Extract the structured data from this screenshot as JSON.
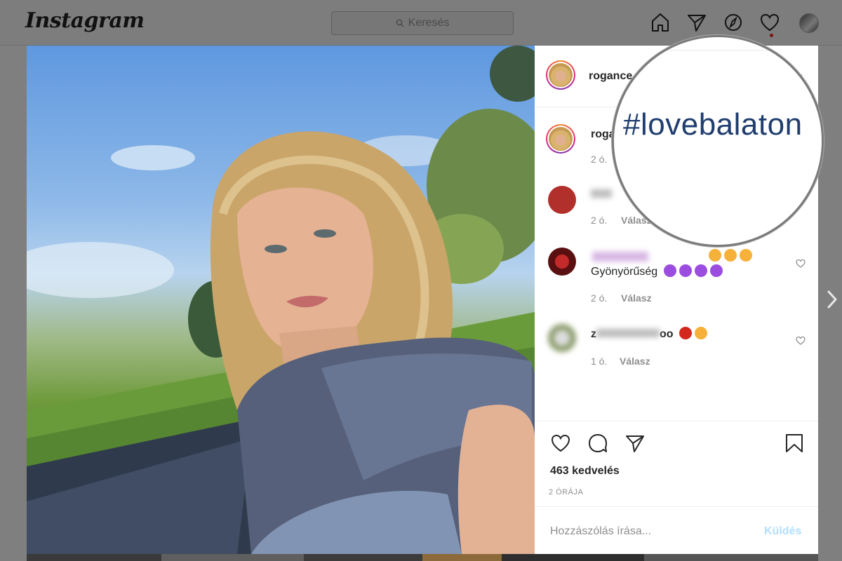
{
  "nav": {
    "logo": "Instagram",
    "search_placeholder": "Keresés",
    "icons": [
      "home-icon",
      "direct-icon",
      "explore-icon",
      "activity-icon",
      "profile-avatar"
    ]
  },
  "post": {
    "username": "rogance",
    "comments": [
      {
        "user": "roga",
        "time": "2 ó.",
        "text": ""
      },
      {
        "user": "",
        "time": "2 ó.",
        "reply": "Válasz",
        "text": ""
      },
      {
        "user": "",
        "time": "2 ó.",
        "reply": "Válasz",
        "text": "Gyönyörűség"
      },
      {
        "user": "z",
        "user_suffix": "oo",
        "time": "1 ó.",
        "reply": "Válasz",
        "text": ""
      }
    ],
    "likes": "463 kedvelés",
    "posted_ago": "2 ÓRÁJA",
    "comment_placeholder": "Hozzászólás írása...",
    "send_label": "Küldés"
  },
  "magnifier": {
    "hashtag": "#lovebalaton"
  },
  "colors": {
    "overlay": "#7f7f7f",
    "link_blue": "#1f3d6e",
    "send_disabled": "#b2dffc",
    "text_primary": "#262626",
    "text_secondary": "#8e8e8e"
  }
}
